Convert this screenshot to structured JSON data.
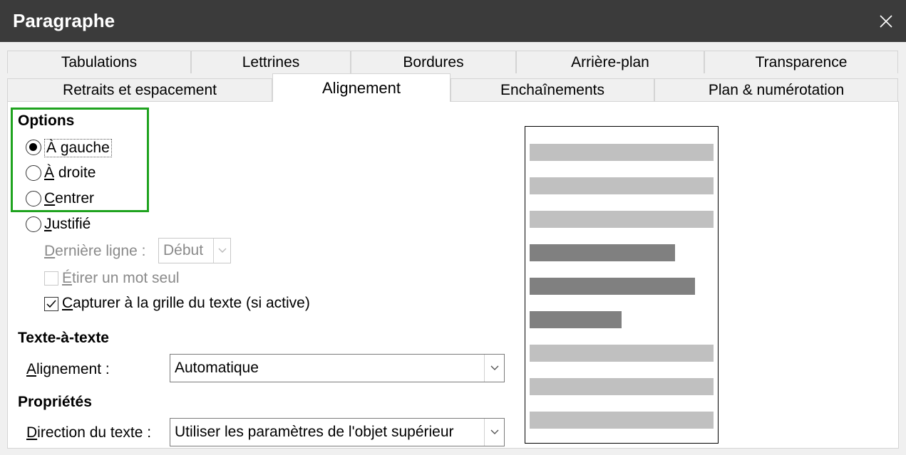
{
  "window": {
    "title": "Paragraphe",
    "close_label": "×"
  },
  "tabs": {
    "row1": [
      "Tabulations",
      "Lettrines",
      "Bordures",
      "Arrière-plan",
      "Transparence"
    ],
    "row2": [
      "Retraits et espacement",
      "Alignement",
      "Enchaînements",
      "Plan & numérotation"
    ],
    "active": "Alignement"
  },
  "options": {
    "heading": "Options",
    "left": "À gauche",
    "right": "À droite",
    "center": "Centrer",
    "justify": "Justifié",
    "selected": "À gauche",
    "last_line_label": "Dernière ligne :",
    "last_line_value": "Début",
    "stretch_word": "Étirer un mot seul",
    "snap_grid": "Capturer à la grille du texte (si active)"
  },
  "text_to_text": {
    "heading": "Texte-à-texte",
    "alignment_label": "Alignement :",
    "alignment_value": "Automatique"
  },
  "properties": {
    "heading": "Propriétés",
    "direction_label": "Direction du texte :",
    "direction_value": "Utiliser les paramètres de l'objet supérieur"
  },
  "preview": {
    "light_color": "#c0c0c0",
    "dark_color": "#808080",
    "bars": [
      {
        "shade": "light",
        "fill": 1.0
      },
      {
        "shade": "light",
        "fill": 1.0
      },
      {
        "shade": "light",
        "fill": 1.0
      },
      {
        "shade": "dark",
        "fill": 0.79
      },
      {
        "shade": "dark",
        "fill": 0.9
      },
      {
        "shade": "dark",
        "fill": 0.5
      },
      {
        "shade": "light",
        "fill": 1.0
      },
      {
        "shade": "light",
        "fill": 1.0
      },
      {
        "shade": "light",
        "fill": 1.0
      }
    ]
  },
  "colors": {
    "highlight": "#1fa31f",
    "titlebar": "#3b3b3b"
  }
}
